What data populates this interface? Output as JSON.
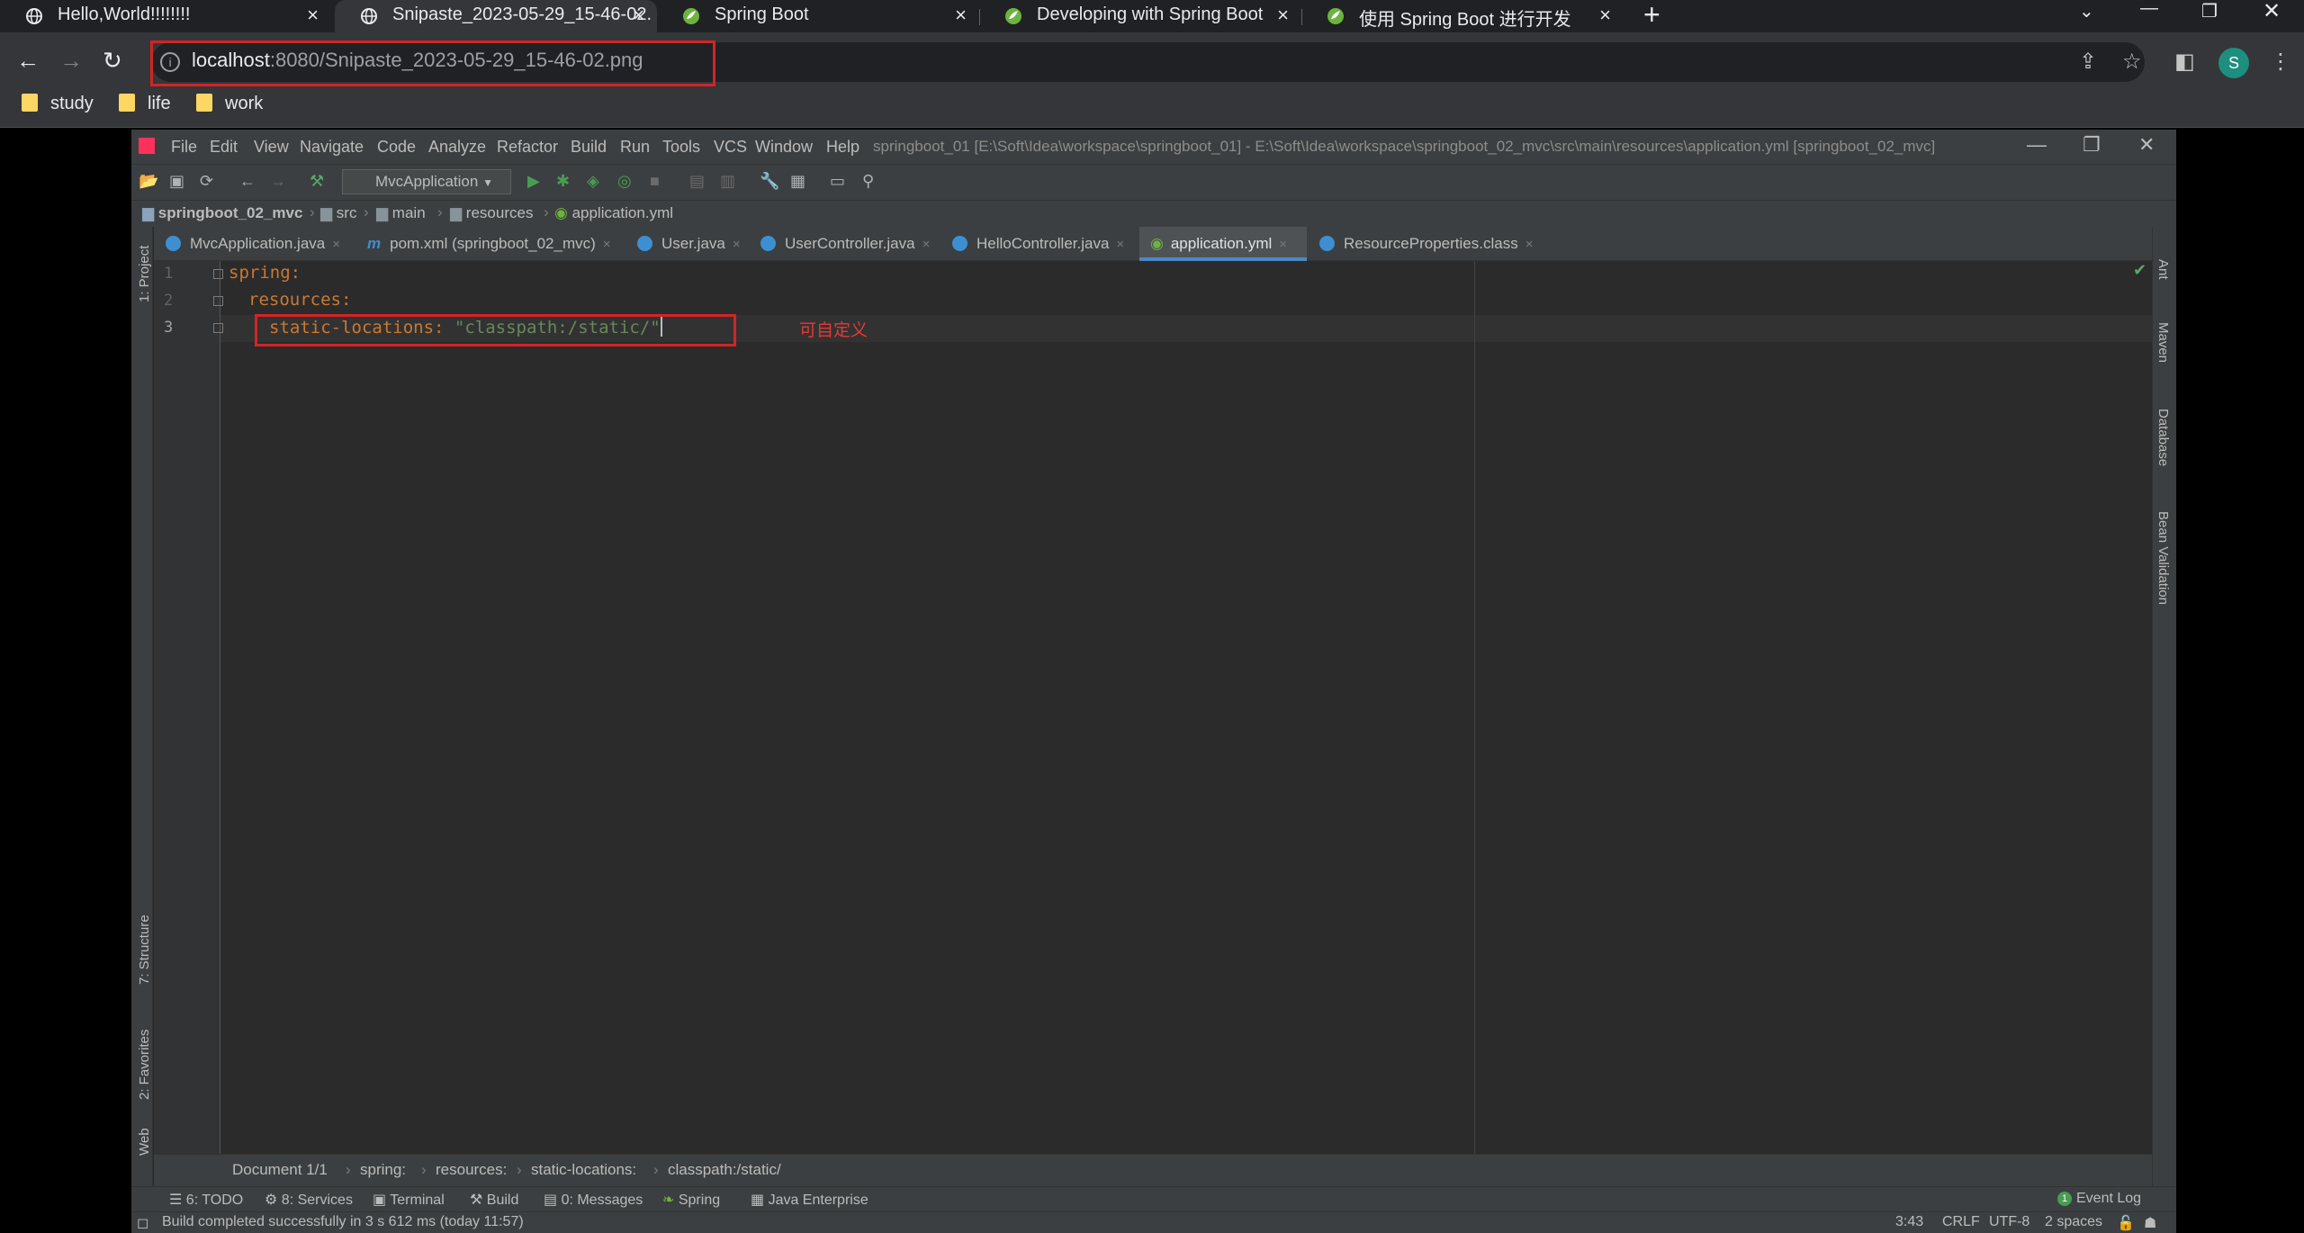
{
  "browser": {
    "tabs": [
      {
        "title": "Hello,World!!!!!!!!",
        "icon": "globe-icon"
      },
      {
        "title": "Snipaste_2023-05-29_15-46-02.",
        "icon": "globe-icon"
      },
      {
        "title": "Spring Boot",
        "icon": "spring-icon"
      },
      {
        "title": "Developing with Spring Boot",
        "icon": "spring-icon"
      },
      {
        "title": "使用 Spring Boot 进行开发",
        "icon": "spring-icon"
      }
    ],
    "new_tab": "+",
    "address": {
      "host": "localhost",
      "rest": ":8080/Snipaste_2023-05-29_15-46-02.png"
    },
    "profile_initial": "S",
    "bookmarks": [
      "study",
      "life",
      "work"
    ]
  },
  "ide": {
    "menu": [
      "File",
      "Edit",
      "View",
      "Navigate",
      "Code",
      "Analyze",
      "Refactor",
      "Build",
      "Run",
      "Tools",
      "VCS",
      "Window",
      "Help"
    ],
    "title_path": "springboot_01 [E:\\Soft\\Idea\\workspace\\springboot_01] - E:\\Soft\\Idea\\workspace\\springboot_02_mvc\\src\\main\\resources\\application.yml [springboot_02_mvc]",
    "run_config": "MvcApplication",
    "breadcrumb": [
      "springboot_02_mvc",
      "src",
      "main",
      "resources",
      "application.yml"
    ],
    "editor_tabs": [
      {
        "label": "MvcApplication.java"
      },
      {
        "label": "pom.xml (springboot_02_mvc)"
      },
      {
        "label": "User.java"
      },
      {
        "label": "UserController.java"
      },
      {
        "label": "HelloController.java"
      },
      {
        "label": "application.yml",
        "active": true
      },
      {
        "label": "ResourceProperties.class"
      }
    ],
    "left_panels": [
      "1: Project",
      "7: Structure",
      "2: Favorites",
      "Web"
    ],
    "right_panels": [
      "Ant",
      "Maven",
      "Database",
      "Bean Validation"
    ],
    "code": {
      "lines": [
        "1",
        "2",
        "3"
      ],
      "l1_key": "spring:",
      "l2_key": "resources:",
      "l3_key": "static-locations:",
      "l3_value": "\"classpath:/static/\""
    },
    "annotation": "可自定义",
    "editor_breadcrumb": [
      "Document 1/1",
      "spring:",
      "resources:",
      "static-locations:",
      "classpath:/static/"
    ],
    "tool_windows": [
      "6: TODO",
      "8: Services",
      "Terminal",
      "Build",
      "0: Messages",
      "Spring",
      "Java Enterprise"
    ],
    "event_log": "Event Log",
    "event_count": "1",
    "status": {
      "message": "Build completed successfully in 3 s 612 ms (today 11:57)",
      "position": "3:43",
      "line_sep": "CRLF",
      "encoding": "UTF-8",
      "indent": "2 spaces"
    }
  }
}
